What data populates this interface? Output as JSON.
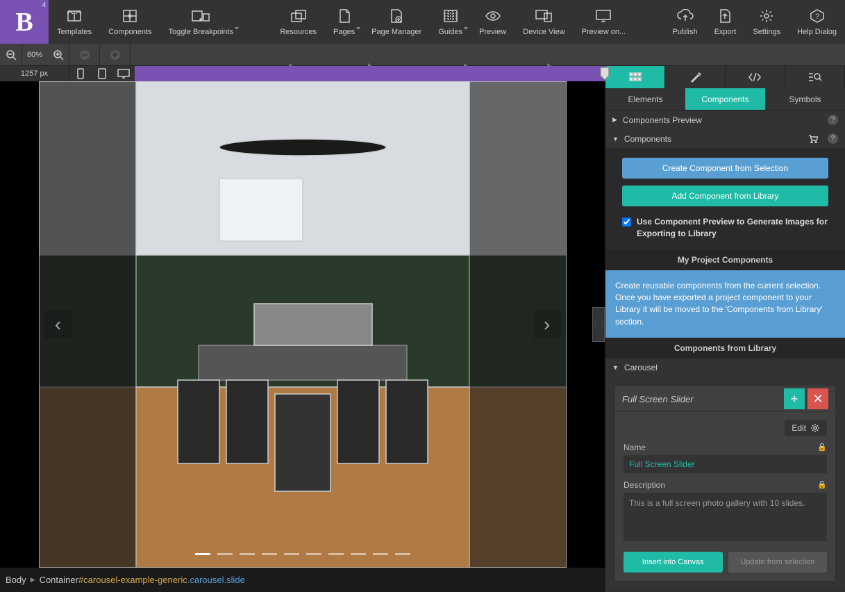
{
  "logo": {
    "letter": "B",
    "version": "4"
  },
  "toolbar": {
    "templates": "Templates",
    "components": "Components",
    "toggle_breakpoints": "Toggle Breakpoints",
    "resources": "Resources",
    "pages": "Pages",
    "page_manager": "Page Manager",
    "guides": "Guides",
    "preview": "Preview",
    "device_view": "Device View",
    "preview_on": "Preview on...",
    "publish": "Publish",
    "export": "Export",
    "settings": "Settings",
    "help_dialog": "Help Dialog"
  },
  "zoom": {
    "value": "60%"
  },
  "ruler": {
    "width_px": "1257 px"
  },
  "breadcrumb": {
    "body": "Body",
    "container": "Container",
    "id": "#carousel-example-generic",
    "classes": ".carousel.slide"
  },
  "right": {
    "tabs": {
      "elements": "Elements",
      "components": "Components",
      "symbols": "Symbols"
    },
    "sections": {
      "preview": "Components Preview",
      "components": "Components"
    },
    "buttons": {
      "create_from_selection": "Create Component from Selection",
      "add_from_library": "Add Component from Library"
    },
    "checkbox_label": "Use Component Preview to Generate Images for Exporting to Library",
    "my_project": "My Project Components",
    "info_text": "Create reusable components from the current selection. Once you have exported a project component to your Library it will be moved to the 'Components from Library' section.",
    "from_library": "Components from Library",
    "carousel_section": "Carousel",
    "component": {
      "title": "Full Screen Slider",
      "edit": "Edit",
      "name_label": "Name",
      "name_value": "Full Screen Slider",
      "desc_label": "Description",
      "desc_value": "This is a full screen photo gallery with 10 slides.",
      "insert": "Insert into Canvas",
      "update": "Update from selection"
    }
  }
}
